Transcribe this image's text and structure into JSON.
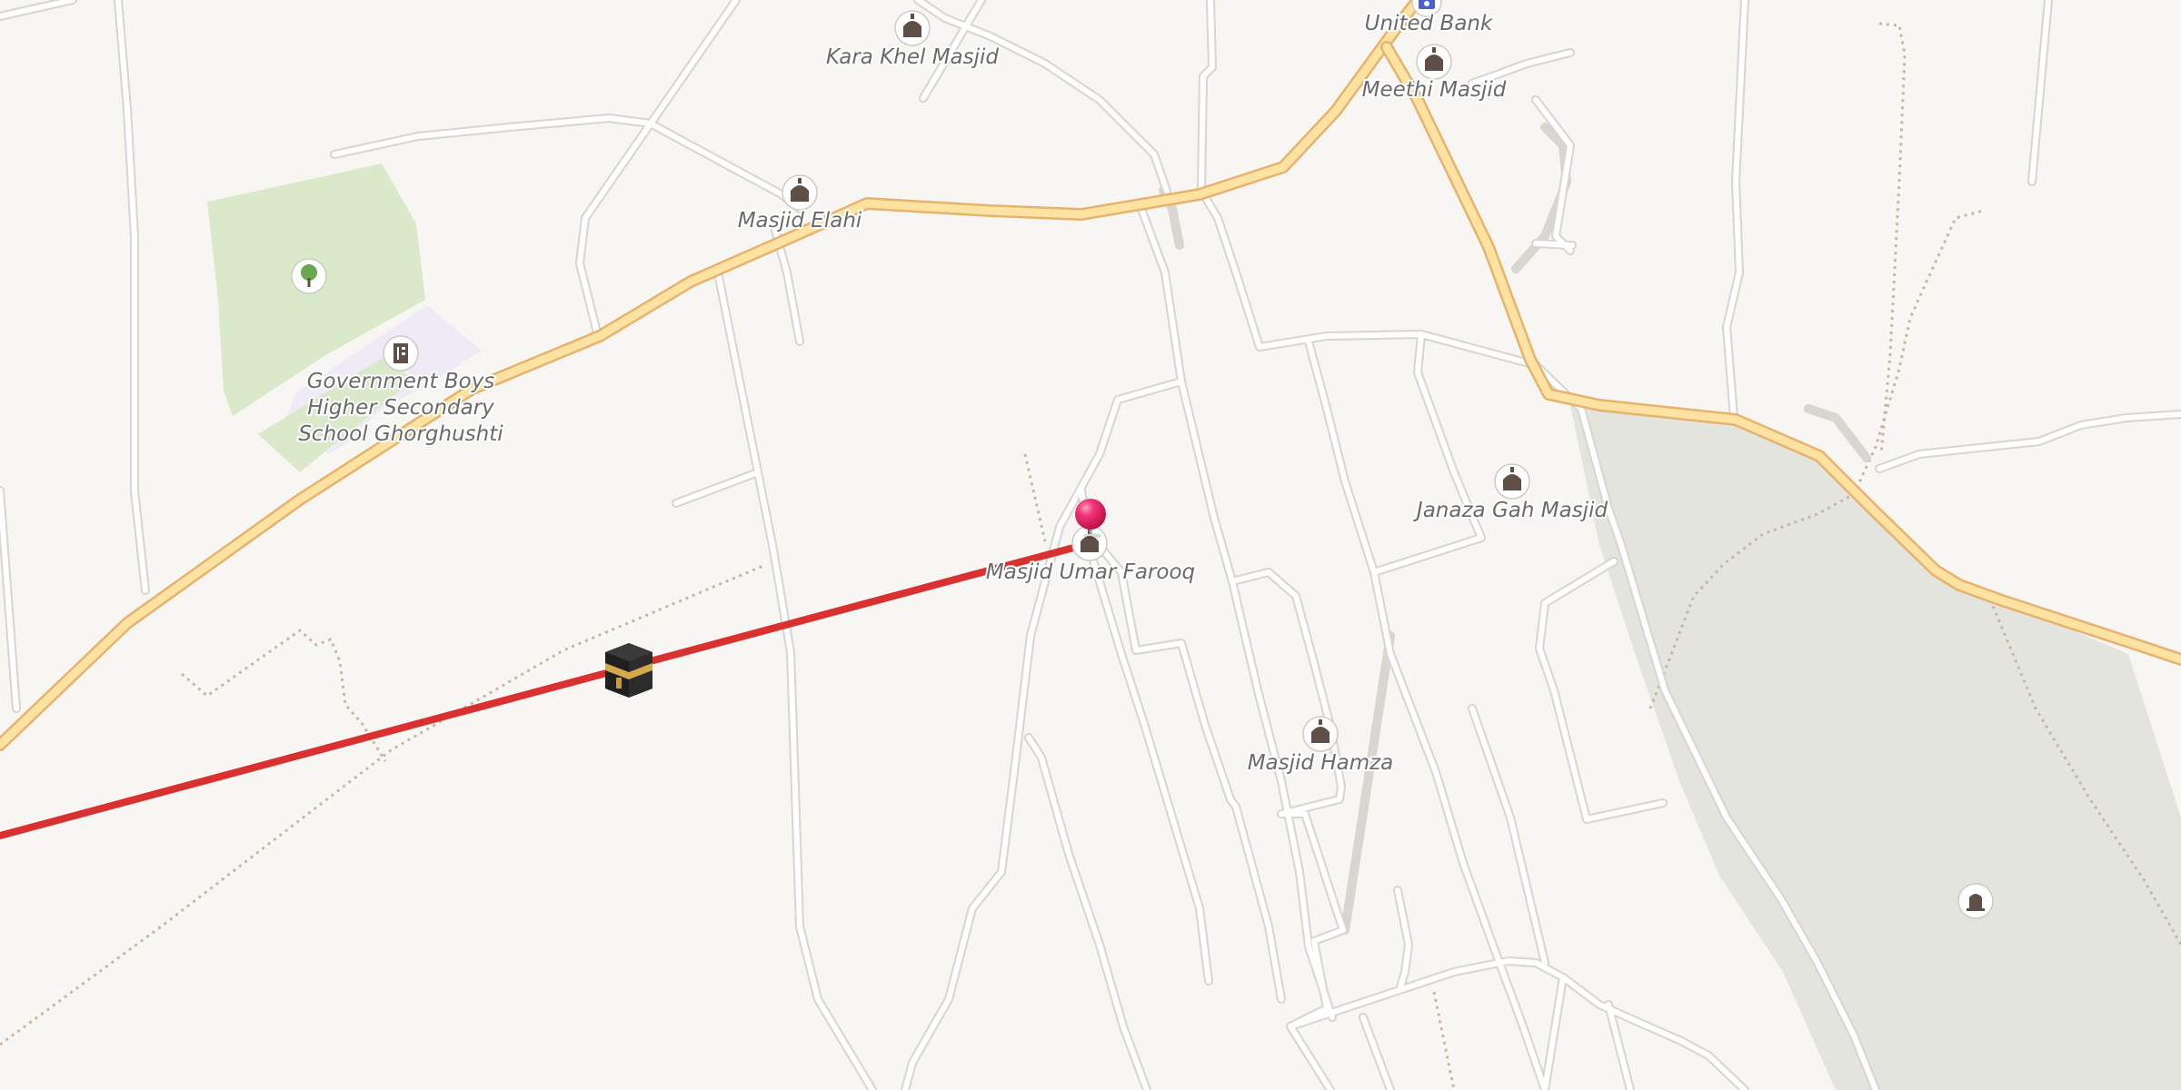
{
  "map": {
    "colors": {
      "background": "#f8f6f3",
      "park": "#d9e9c9",
      "cemetery_area": "#e2e4dd",
      "school_area": "#eeeaf6",
      "minor_road": "#ffffff",
      "major_road": "#fde2a2",
      "major_road_casing": "#e6b36e",
      "route_line": "#d93030",
      "marker": "#e5235f",
      "label_text": "#6a6a6a"
    },
    "labels": {
      "kara_khel": "Kara Khel Masjid",
      "united_bank": "United Bank",
      "meethi": "Meethi Masjid",
      "elahi": "Masjid Elahi",
      "school_line1": "Government Boys",
      "school_line2": "Higher Secondary",
      "school_line3": "School Ghorghushti",
      "umar_farooq": "Masjid Umar Farooq",
      "janaza_gah": "Janaza Gah Masjid",
      "hamza": "Masjid Hamza"
    },
    "icons": {
      "mosque": "mosque-icon",
      "bank": "bank-icon",
      "park": "tree-icon",
      "school": "school-icon",
      "qibla": "kaaba-icon",
      "cemetery": "grave-icon",
      "marker": "location-pin-icon"
    }
  }
}
